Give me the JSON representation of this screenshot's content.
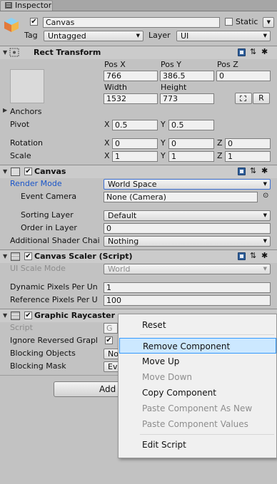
{
  "window": {
    "tab_label": "Inspector"
  },
  "gameobject": {
    "name": "Canvas",
    "static_label": "Static",
    "tag_label": "Tag",
    "tag_value": "Untagged",
    "layer_label": "Layer",
    "layer_value": "UI"
  },
  "rect_transform": {
    "title": "Rect Transform",
    "pos_x_label": "Pos X",
    "pos_y_label": "Pos Y",
    "pos_z_label": "Pos Z",
    "pos_x": "766",
    "pos_y": "386.5",
    "pos_z": "0",
    "width_label": "Width",
    "height_label": "Height",
    "width": "1532",
    "height": "773",
    "r_button": "R",
    "anchors_label": "Anchors",
    "pivot_label": "Pivot",
    "pivot_x": "0.5",
    "pivot_y": "0.5",
    "rotation_label": "Rotation",
    "rot_x": "0",
    "rot_y": "0",
    "rot_z": "0",
    "scale_label": "Scale",
    "scale_x": "1",
    "scale_y": "1",
    "scale_z": "1",
    "x_label": "X",
    "y_label": "Y",
    "z_label": "Z"
  },
  "canvas": {
    "title": "Canvas",
    "render_mode_label": "Render Mode",
    "render_mode_value": "World Space",
    "event_camera_label": "Event Camera",
    "event_camera_value": "None (Camera)",
    "sorting_layer_label": "Sorting Layer",
    "sorting_layer_value": "Default",
    "order_in_layer_label": "Order in Layer",
    "order_in_layer_value": "0",
    "additional_shader_label": "Additional Shader Chai",
    "additional_shader_value": "Nothing"
  },
  "canvas_scaler": {
    "title": "Canvas Scaler (Script)",
    "ui_scale_mode_label": "UI Scale Mode",
    "ui_scale_mode_value": "World",
    "dynamic_pixels_label": "Dynamic Pixels Per Un",
    "dynamic_pixels_value": "1",
    "reference_pixels_label": "Reference Pixels Per U",
    "reference_pixels_value": "100"
  },
  "graphic_raycaster": {
    "title": "Graphic Raycaster (Script)",
    "script_label": "Script",
    "script_value": "G",
    "ignore_reversed_label": "Ignore Reversed Grapl",
    "blocking_objects_label": "Blocking Objects",
    "blocking_objects_value": "No",
    "blocking_mask_label": "Blocking Mask",
    "blocking_mask_value": "Ev"
  },
  "add_component_label": "Add",
  "context_menu": {
    "items": [
      {
        "label": "Reset",
        "enabled": true
      },
      {
        "label": "Remove Component",
        "enabled": true,
        "highlighted": true
      },
      {
        "label": "Move Up",
        "enabled": true
      },
      {
        "label": "Move Down",
        "enabled": false
      },
      {
        "label": "Copy Component",
        "enabled": true
      },
      {
        "label": "Paste Component As New",
        "enabled": false
      },
      {
        "label": "Paste Component Values",
        "enabled": false
      },
      {
        "label": "Edit Script",
        "enabled": true
      }
    ]
  },
  "colors": {
    "highlight": "#cce8ff",
    "link_blue": "#1a55c8",
    "panel_bg": "#c2c2c2"
  }
}
